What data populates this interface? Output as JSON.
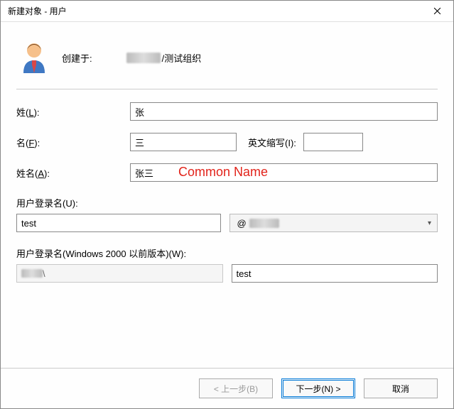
{
  "window": {
    "title": "新建对象 - 用户"
  },
  "header": {
    "created_label": "创建于:",
    "path_suffix": "/测试组织"
  },
  "form": {
    "last_name_label_pre": "姓(",
    "last_name_key": "L",
    "last_name_label_post": "):",
    "last_name_value": "张",
    "first_name_label_pre": "名(",
    "first_name_key": "F",
    "first_name_label_post": "):",
    "first_name_value": "三",
    "initials_label_pre": "英文缩写(",
    "initials_key": "I",
    "initials_label_post": "):",
    "initials_value": "",
    "full_name_label_pre": "姓名(",
    "full_name_key": "A",
    "full_name_label_post": "):",
    "full_name_value": "张三",
    "annotation": "Common Name",
    "logon_label_pre": "用户登录名(",
    "logon_key": "U",
    "logon_label_post": "):",
    "logon_value": "test",
    "domain_prefix": "@",
    "logon2000_label_pre": "用户登录名(Windows 2000 以前版本)(",
    "logon2000_key": "W",
    "logon2000_label_post": "):",
    "logon2000_value": "test"
  },
  "buttons": {
    "back": "< 上一步(B)",
    "next": "下一步(N) >",
    "cancel": "取消"
  }
}
